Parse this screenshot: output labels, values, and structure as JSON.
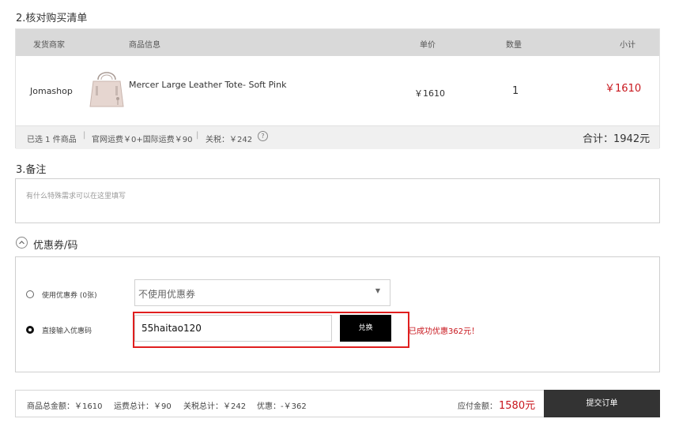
{
  "section2": {
    "title": "2.核对购买清单"
  },
  "table": {
    "headers": {
      "seller": "发货商家",
      "product": "商品信息",
      "price": "单价",
      "qty": "数量",
      "subtotal": "小计"
    },
    "row": {
      "seller": "Jomashop",
      "product_name": "Mercer Large Leather Tote- Soft Pink",
      "price": "￥1610",
      "qty": "1",
      "subtotal": "￥1610"
    },
    "summary": {
      "count": "已选 1 件商品",
      "shipping": "官网运费￥0+国际运费￥90",
      "tax": "关税：￥242",
      "total": "合计：1942元"
    }
  },
  "section3": {
    "title": "3.备注",
    "placeholder": "有什么特殊需求可以在这里填写"
  },
  "coupon": {
    "toggle_label": "优惠券/码",
    "use_coupon_label": "使用优惠券 (0张)",
    "select_value": "不使用优惠券",
    "direct_code_label": "直接输入优惠码",
    "code_value": "55haitao120",
    "exchange_button": "兑换",
    "success_message": "已成功优惠362元！"
  },
  "footer": {
    "goods_total": "商品总金额：￥1610",
    "shipping_total": "运费总计：￥90",
    "tax_total": "关税总计：￥242",
    "discount": "优惠：-￥362",
    "payable_label": "应付金额：",
    "payable_value": "1580元",
    "submit_button": "提交订单"
  },
  "colors": {
    "accent_red": "#c8161d",
    "dark_button": "#333333",
    "header_gray": "#d9d9d9"
  }
}
